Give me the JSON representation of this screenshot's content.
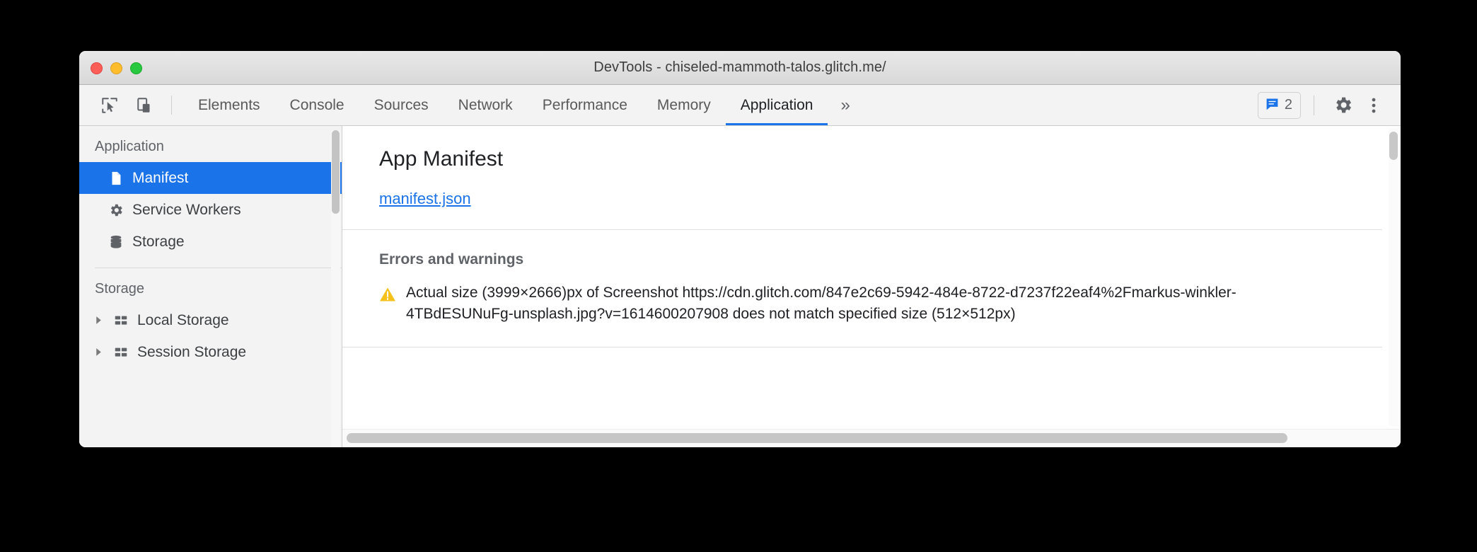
{
  "window": {
    "title": "DevTools - chiseled-mammoth-talos.glitch.me/",
    "traffic_lights": [
      "close",
      "minimize",
      "zoom"
    ]
  },
  "toolbar": {
    "inspect_icon": "inspect-cursor-icon",
    "device_icon": "device-toolbar-icon",
    "tabs": [
      {
        "label": "Elements",
        "active": false
      },
      {
        "label": "Console",
        "active": false
      },
      {
        "label": "Sources",
        "active": false
      },
      {
        "label": "Network",
        "active": false
      },
      {
        "label": "Performance",
        "active": false
      },
      {
        "label": "Memory",
        "active": false
      },
      {
        "label": "Application",
        "active": true
      }
    ],
    "more_tabs_glyph": "»",
    "message_badge": {
      "icon": "message-bubble-icon",
      "count": "2",
      "color": "#1a73e8"
    },
    "settings_icon": "gear-icon",
    "more_options_icon": "kebab-menu-icon",
    "active_underline_color": "#1a73e8"
  },
  "sidebar": {
    "sections": [
      {
        "title": "Application",
        "items": [
          {
            "label": "Manifest",
            "icon": "document-icon",
            "selected": true,
            "twisty": false
          },
          {
            "label": "Service Workers",
            "icon": "gear-icon",
            "selected": false,
            "twisty": false
          },
          {
            "label": "Storage",
            "icon": "database-icon",
            "selected": false,
            "twisty": false
          }
        ]
      },
      {
        "title": "Storage",
        "items": [
          {
            "label": "Local Storage",
            "icon": "table-icon",
            "selected": false,
            "twisty": true
          },
          {
            "label": "Session Storage",
            "icon": "table-icon",
            "selected": false,
            "twisty": true
          }
        ]
      }
    ],
    "selected_background": "#1a73e8"
  },
  "main": {
    "heading": "App Manifest",
    "manifest_link": "manifest.json",
    "errors_heading": "Errors and warnings",
    "errors": [
      {
        "severity": "warning",
        "icon": "warning-triangle-icon",
        "color": "#f5c11a",
        "text": "Actual size (3999×2666)px of Screenshot https://cdn.glitch.com/847e2c69-5942-484e-8722-d7237f22eaf4%2Fmarkus-winkler-4TBdESUNuFg-unsplash.jpg?v=1614600207908 does not match specified size (512×512px)"
      }
    ]
  }
}
